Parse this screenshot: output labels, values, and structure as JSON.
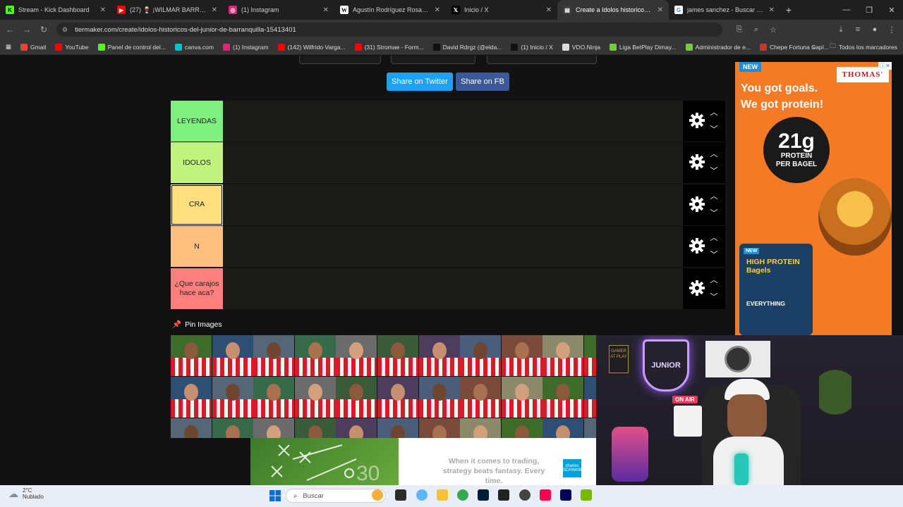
{
  "tabs": [
    {
      "title": "Stream - Kick Dashboard",
      "icon": "kick-icon",
      "active": false
    },
    {
      "title": "(27) 🍷 ¡WILMAR BARRIOS Y A",
      "icon": "youtube-icon",
      "active": false
    },
    {
      "title": "(1) Instagram",
      "icon": "instagram-icon",
      "active": false
    },
    {
      "title": "Agustín Rodríguez Rosano - Wi",
      "icon": "wikipedia-icon",
      "active": false
    },
    {
      "title": "Inicio / X",
      "icon": "x-icon",
      "active": false
    },
    {
      "title": "Create a Idolos historicos del Ju",
      "icon": "tiermaker-icon",
      "active": true
    },
    {
      "title": "james sanchez - Buscar con Go",
      "icon": "google-icon",
      "active": false
    }
  ],
  "address_bar": {
    "url": "tiermaker.com/create/idolos-historicos-del-junior-de-barranquilla-15413401"
  },
  "bookmarks": [
    {
      "label": "Gmail",
      "icon": "gmail-icon",
      "color": "#ea4335"
    },
    {
      "label": "YouTube",
      "icon": "youtube-icon",
      "color": "#ff0000"
    },
    {
      "label": "Panel de control del...",
      "icon": "kick-icon",
      "color": "#53fc18"
    },
    {
      "label": "canva.com",
      "icon": "canva-icon",
      "color": "#00c4cc"
    },
    {
      "label": "(1) Instagram",
      "icon": "instagram-icon",
      "color": "#d62976"
    },
    {
      "label": "(142) Wilfrido Varga...",
      "icon": "youtube-icon",
      "color": "#ff0000"
    },
    {
      "label": "(31) Stromae - Form...",
      "icon": "youtube-icon",
      "color": "#ff0000"
    },
    {
      "label": "David Rdrgz (@elda...",
      "icon": "tiktok-icon",
      "color": "#111111"
    },
    {
      "label": "(1) Inicio / X",
      "icon": "x-icon",
      "color": "#111111"
    },
    {
      "label": "VDO.Ninja",
      "icon": "vdo-icon",
      "color": "#dddddd"
    },
    {
      "label": "Liga BetPlay Dimay...",
      "icon": "android-icon",
      "color": "#7ac943"
    },
    {
      "label": "Administrador de e...",
      "icon": "puzzle-icon",
      "color": "#7ac943"
    },
    {
      "label": "Chepe Fortuna Capí...",
      "icon": "page-icon",
      "color": "#c0392b"
    }
  ],
  "bookmarks_more": "»",
  "all_bookmarks": "Todos los marcadores",
  "share": {
    "twitter": "Share on Twitter",
    "facebook": "Share on FB"
  },
  "tiers": [
    {
      "label": "LEYENDAS",
      "color": "#7ff07f",
      "selected": false
    },
    {
      "label": "IDOLOS",
      "color": "#c0f47f",
      "selected": false
    },
    {
      "label": "CRA",
      "color": "#ffdf7f",
      "selected": true
    },
    {
      "label": "N",
      "color": "#ffbf7f",
      "selected": false
    },
    {
      "label": "¿Que carajos hace aca?",
      "color": "#ff7f7f",
      "selected": false
    }
  ],
  "pin_images": "Pin Images",
  "ad_right": {
    "badge": "NEW",
    "brand": "THOMAS'",
    "headline1": "You got goals.",
    "headline2": "We got protein!",
    "big": "21g",
    "protein": "PROTEIN",
    "per": "PER BAGEL",
    "bag_badge": "NEW",
    "bag_brand": "THOMAS'",
    "bag_title": "HIGH PROTEIN Bagels",
    "bag_flavor": "EVERYTHING"
  },
  "ad_bottom": {
    "text": "When it comes to trading, strategy beats fantasy. Every time.",
    "logo": "charles SCHWAB"
  },
  "webcam": {
    "sign": "JUNIOR",
    "on_air": "ON AIR",
    "banner": "GAMER AT PLAY"
  },
  "taskbar": {
    "temp": "2°C",
    "weather": "Nublado",
    "search_placeholder": "Buscar"
  }
}
